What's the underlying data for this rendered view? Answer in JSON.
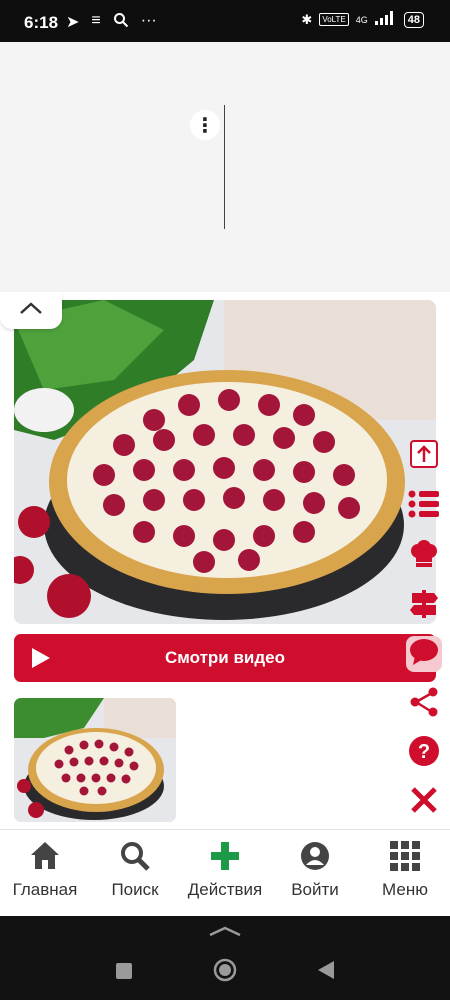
{
  "status_bar": {
    "time": "6:18",
    "left_icons": [
      "telegram-icon",
      "notes-icon",
      "search-icon",
      "more-icon"
    ],
    "signal_tag": "VoLTE",
    "network": "4G",
    "battery": "48"
  },
  "ad": {
    "menu_glyph": "⋮"
  },
  "video_button": {
    "label": "Смотри видео"
  },
  "side_tools": [
    "share-upload-icon",
    "list-icon",
    "chef-hat-icon",
    "signpost-icon",
    "comment-icon",
    "share-icon",
    "help-icon",
    "close-icon"
  ],
  "bottom_nav": {
    "items": [
      {
        "label": "Главная",
        "icon": "home-icon"
      },
      {
        "label": "Поиск",
        "icon": "search-icon"
      },
      {
        "label": "Действия",
        "icon": "plus-icon"
      },
      {
        "label": "Войти",
        "icon": "user-icon"
      },
      {
        "label": "Меню",
        "icon": "grid-icon"
      }
    ]
  },
  "colors": {
    "accent": "#cf0d2c",
    "action_green": "#1c9a48",
    "nav_text": "#333333"
  }
}
